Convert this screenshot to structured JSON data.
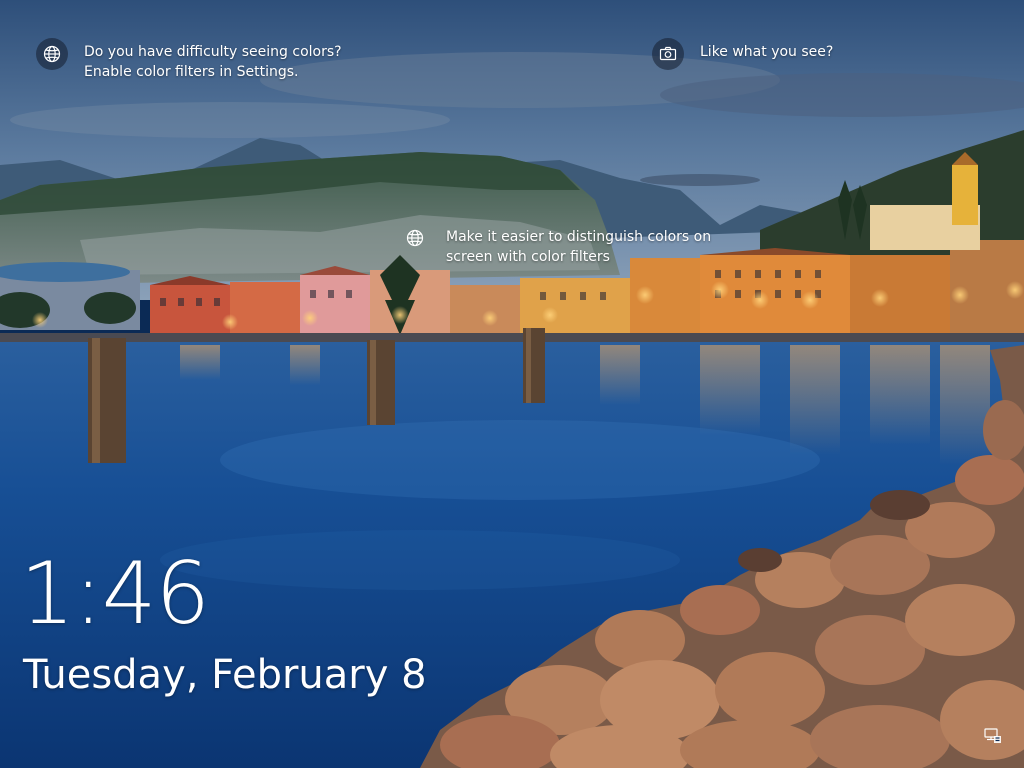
{
  "lock_screen": {
    "tips": [
      {
        "icon": "globe-icon",
        "line1": "Do you have difficulty seeing colors?",
        "line2": "Enable color filters in Settings."
      },
      {
        "icon": "camera-icon",
        "line1": "Like what you see?"
      },
      {
        "icon": "globe-icon",
        "line1": "Make it easier to distinguish colors on",
        "line2": "screen with color filters"
      }
    ],
    "time": "1:46",
    "date": "Tuesday, February 8",
    "status_icons": [
      "network-icon"
    ]
  },
  "colors": {
    "text": "#ffffff",
    "sky": "#3f5f86",
    "water": "#144a8c",
    "rocks": "#b87a58",
    "lights": "#f4b04a"
  }
}
